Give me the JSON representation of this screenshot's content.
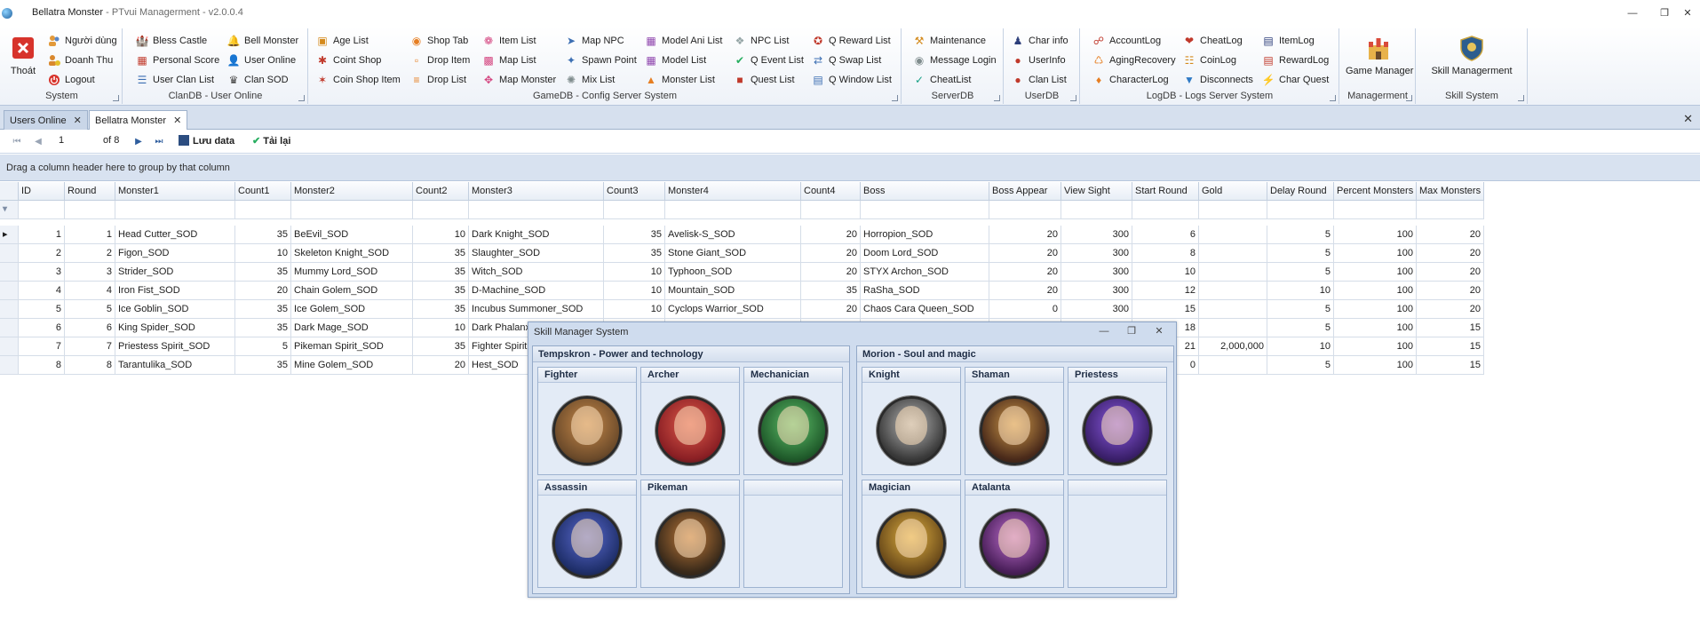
{
  "window": {
    "title_main": "Bellatra Monster",
    "title_sep": " - ",
    "title_app": "PTvui Managerment - v2.0.0.4"
  },
  "ribbon": {
    "system": {
      "label": "System",
      "exit_label": "Thoát",
      "items": [
        "Người dùng",
        "Doanh Thu",
        "Logout"
      ]
    },
    "clandb": {
      "label": "ClanDB - User Online",
      "col1": [
        "Bless Castle",
        "Personal Score",
        "User Clan List"
      ],
      "col2": [
        "Bell Monster",
        "User Online",
        "Clan SOD"
      ]
    },
    "gamedb": {
      "label": "GameDB - Config Server System",
      "col1": [
        "Age List",
        "Coint Shop",
        "Coin Shop Item"
      ],
      "col2": [
        "Shop Tab",
        "Drop Item",
        "Drop List"
      ],
      "col3": [
        "Item List",
        "Map List",
        "Map Monster"
      ],
      "col4": [
        "Map NPC",
        "Spawn Point",
        "Mix List"
      ],
      "col5": [
        "Model Ani List",
        "Model List",
        "Monster List"
      ],
      "col6": [
        "NPC List",
        "Q Event List",
        "Quest List"
      ],
      "col7": [
        "Q Reward List",
        "Q Swap List",
        "Q Window List"
      ]
    },
    "serverdb": {
      "label": "ServerDB",
      "items": [
        "Maintenance",
        "Message Login",
        "CheatList"
      ]
    },
    "userdb": {
      "label": "UserDB",
      "items": [
        "Char info",
        "UserInfo",
        "Clan List"
      ]
    },
    "logdb": {
      "label": "LogDB - Logs Server System",
      "col1": [
        "AccountLog",
        "AgingRecovery",
        "CharacterLog"
      ],
      "col2": [
        "CheatLog",
        "CoinLog",
        "Disconnects"
      ],
      "col3": [
        "ItemLog",
        "RewardLog",
        "Char Quest"
      ]
    },
    "managerment": {
      "label": "Managerment",
      "item": "Game Manager"
    },
    "skill": {
      "label": "Skill System",
      "item": "Skill Managerment"
    }
  },
  "tabs": [
    {
      "label": "Users Online"
    },
    {
      "label": "Bellatra Monster"
    }
  ],
  "navigator": {
    "page": "1",
    "of": "of 8",
    "save_label": "Lưu data",
    "reload_label": "Tải lại"
  },
  "group_panel_text": "Drag a column header here to group by that column",
  "grid": {
    "columns": [
      "ID",
      "Round",
      "Monster1",
      "Count1",
      "Monster2",
      "Count2",
      "Monster3",
      "Count3",
      "Monster4",
      "Count4",
      "Boss",
      "Boss Appear",
      "View Sight",
      "Start Round",
      "Gold",
      "Delay Round",
      "Percent Monsters",
      "Max Monsters"
    ],
    "filter_symbol": "=",
    "rows": [
      [
        "1",
        "1",
        "Head Cutter_SOD",
        "35",
        "BeEvil_SOD",
        "10",
        "Dark Knight_SOD",
        "35",
        "Avelisk-S_SOD",
        "20",
        "Horropion_SOD",
        "20",
        "300",
        "6",
        "",
        "5",
        "100",
        "20"
      ],
      [
        "2",
        "2",
        "Figon_SOD",
        "10",
        "Skeleton Knight_SOD",
        "35",
        "Slaughter_SOD",
        "35",
        "Stone Giant_SOD",
        "20",
        "Doom Lord_SOD",
        "20",
        "300",
        "8",
        "",
        "5",
        "100",
        "20"
      ],
      [
        "3",
        "3",
        "Strider_SOD",
        "35",
        "Mummy Lord_SOD",
        "35",
        "Witch_SOD",
        "10",
        "Typhoon_SOD",
        "20",
        "STYX Archon_SOD",
        "20",
        "300",
        "10",
        "",
        "5",
        "100",
        "20"
      ],
      [
        "4",
        "4",
        "Iron Fist_SOD",
        "20",
        "Chain Golem_SOD",
        "35",
        "D-Machine_SOD",
        "10",
        "Mountain_SOD",
        "35",
        "RaSha_SOD",
        "20",
        "300",
        "12",
        "",
        "10",
        "100",
        "20"
      ],
      [
        "5",
        "5",
        "Ice Goblin_SOD",
        "35",
        "Ice Golem_SOD",
        "35",
        "Incubus Summoner_SOD",
        "10",
        "Cyclops Warrior_SOD",
        "20",
        "Chaos Cara Queen_SOD",
        "0",
        "300",
        "15",
        "",
        "5",
        "100",
        "20"
      ],
      [
        "6",
        "6",
        "King Spider_SOD",
        "35",
        "Dark Mage_SOD",
        "10",
        "Dark Phalanx",
        "",
        "",
        "",
        "",
        "",
        "",
        "18",
        "",
        "5",
        "100",
        "15"
      ],
      [
        "7",
        "7",
        "Priestess Spirit_SOD",
        "5",
        "Pikeman Spirit_SOD",
        "35",
        "Fighter Spirit",
        "",
        "",
        "",
        "",
        "",
        "",
        "21",
        "2,000,000",
        "10",
        "100",
        "15"
      ],
      [
        "8",
        "8",
        "Tarantulika_SOD",
        "35",
        "Mine Golem_SOD",
        "20",
        "Hest_SOD",
        "",
        "",
        "",
        "",
        "",
        "",
        "0",
        "",
        "5",
        "100",
        "15"
      ]
    ]
  },
  "skill_window": {
    "title": "Skill Manager System",
    "realms": [
      {
        "title": "Tempskron - Power and technology",
        "classes": [
          "Fighter",
          "Archer",
          "Mechanician",
          "Assassin",
          "Pikeman",
          ""
        ]
      },
      {
        "title": "Morion - Soul and magic",
        "classes": [
          "Knight",
          "Shaman",
          "Priestess",
          "Magician",
          "Atalanta",
          ""
        ]
      }
    ]
  },
  "colors": {
    "accent": "#1d5e9c",
    "ribbon_bg": "#eef2f8",
    "panel_bg": "#d8e2f0",
    "close_red": "#d7332b"
  },
  "icons": {
    "system": [
      "users-icon",
      "revenue-icon",
      "logout-icon"
    ],
    "exit": "exit-icon"
  }
}
